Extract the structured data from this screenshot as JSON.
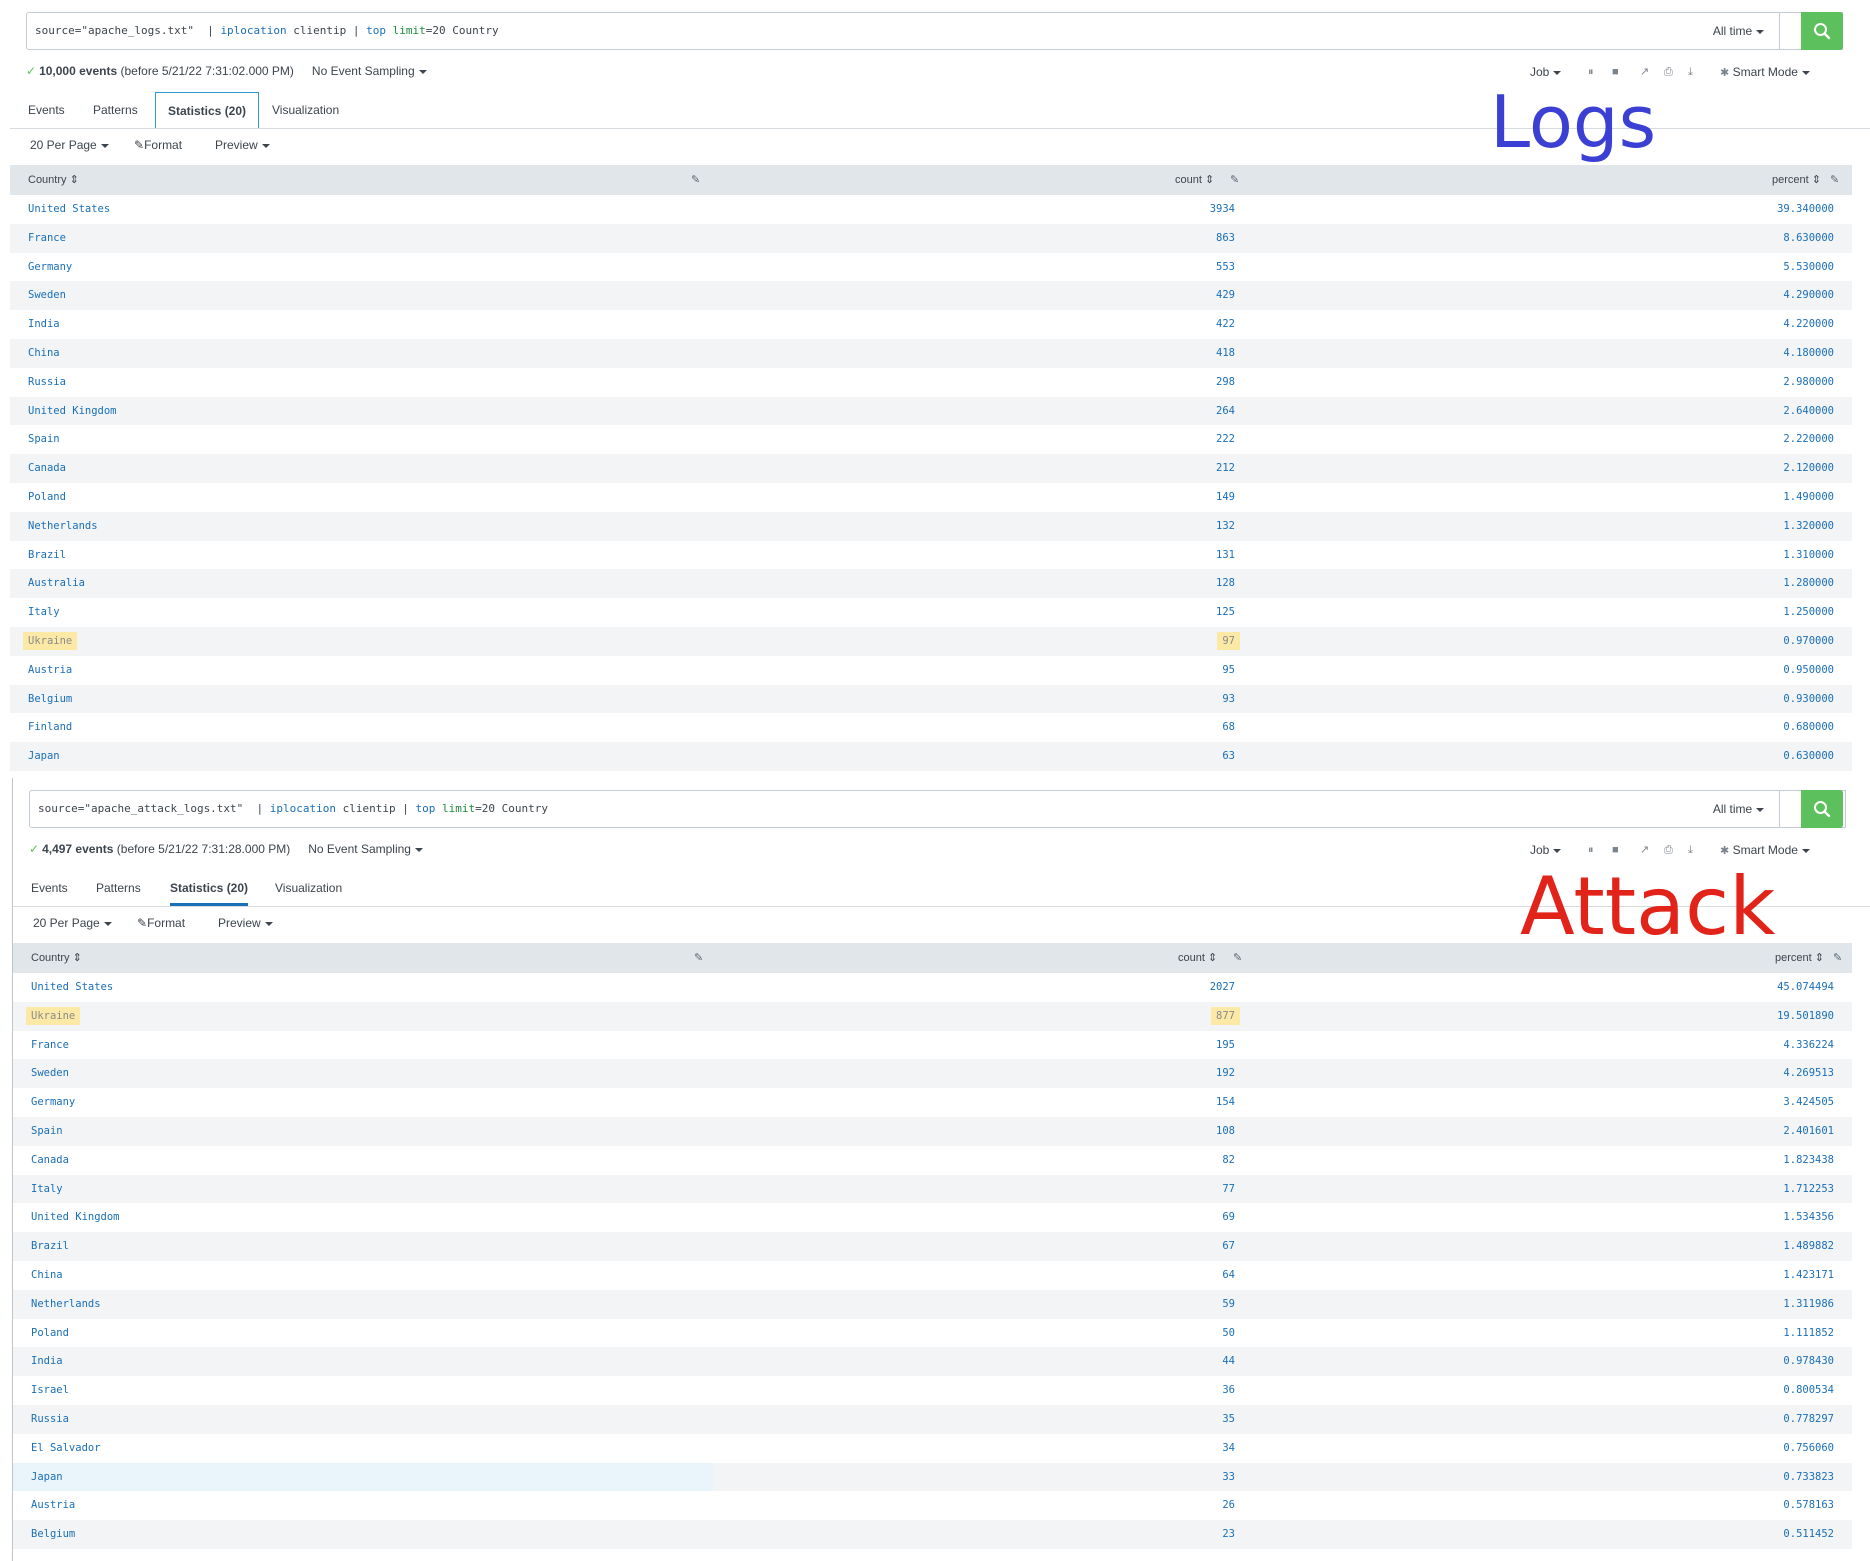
{
  "overlays": {
    "logs": "Logs",
    "attack": "Attack"
  },
  "searches": [
    {
      "query": {
        "source": "source=\"apache_logs.txt\"  | ",
        "cmd1": "iplocation",
        "mid": " clientip | ",
        "cmd2": "top",
        "sp": " ",
        "arg": "limit",
        "rest": "=20 Country"
      },
      "time_range": "All time",
      "status": {
        "count": "10,000 events",
        "detail": "(before 5/21/22 7:31:02.000 PM)",
        "sampling": "No Event Sampling"
      },
      "job": {
        "job": "Job",
        "mode": "Smart Mode"
      },
      "tabs": [
        "Events",
        "Patterns",
        "Statistics (20)",
        "Visualization"
      ],
      "toolbar": {
        "per_page": "20 Per Page",
        "format": "Format",
        "preview": "Preview"
      },
      "columns": [
        "Country",
        "count",
        "percent"
      ],
      "rows": [
        {
          "country": "United States",
          "count": "3934",
          "percent": "39.340000"
        },
        {
          "country": "France",
          "count": "863",
          "percent": "8.630000"
        },
        {
          "country": "Germany",
          "count": "553",
          "percent": "5.530000"
        },
        {
          "country": "Sweden",
          "count": "429",
          "percent": "4.290000"
        },
        {
          "country": "India",
          "count": "422",
          "percent": "4.220000"
        },
        {
          "country": "China",
          "count": "418",
          "percent": "4.180000"
        },
        {
          "country": "Russia",
          "count": "298",
          "percent": "2.980000"
        },
        {
          "country": "United Kingdom",
          "count": "264",
          "percent": "2.640000"
        },
        {
          "country": "Spain",
          "count": "222",
          "percent": "2.220000"
        },
        {
          "country": "Canada",
          "count": "212",
          "percent": "2.120000"
        },
        {
          "country": "Poland",
          "count": "149",
          "percent": "1.490000"
        },
        {
          "country": "Netherlands",
          "count": "132",
          "percent": "1.320000"
        },
        {
          "country": "Brazil",
          "count": "131",
          "percent": "1.310000"
        },
        {
          "country": "Australia",
          "count": "128",
          "percent": "1.280000"
        },
        {
          "country": "Italy",
          "count": "125",
          "percent": "1.250000"
        },
        {
          "country": "Ukraine",
          "count": "97",
          "percent": "0.970000",
          "highlight": true
        },
        {
          "country": "Austria",
          "count": "95",
          "percent": "0.950000"
        },
        {
          "country": "Belgium",
          "count": "93",
          "percent": "0.930000"
        },
        {
          "country": "Finland",
          "count": "68",
          "percent": "0.680000"
        },
        {
          "country": "Japan",
          "count": "63",
          "percent": "0.630000"
        }
      ]
    },
    {
      "query": {
        "source": "source=\"apache_attack_logs.txt\"  | ",
        "cmd1": "iplocation",
        "mid": " clientip | ",
        "cmd2": "top",
        "sp": " ",
        "arg": "limit",
        "rest": "=20 Country"
      },
      "time_range": "All time",
      "status": {
        "count": "4,497 events",
        "detail": "(before 5/21/22 7:31:28.000 PM)",
        "sampling": "No Event Sampling"
      },
      "job": {
        "job": "Job",
        "mode": "Smart Mode"
      },
      "tabs": [
        "Events",
        "Patterns",
        "Statistics (20)",
        "Visualization"
      ],
      "toolbar": {
        "per_page": "20 Per Page",
        "format": "Format",
        "preview": "Preview"
      },
      "columns": [
        "Country",
        "count",
        "percent"
      ],
      "rows": [
        {
          "country": "United States",
          "count": "2027",
          "percent": "45.074494"
        },
        {
          "country": "Ukraine",
          "count": "877",
          "percent": "19.501890",
          "highlight": true
        },
        {
          "country": "France",
          "count": "195",
          "percent": "4.336224"
        },
        {
          "country": "Sweden",
          "count": "192",
          "percent": "4.269513"
        },
        {
          "country": "Germany",
          "count": "154",
          "percent": "3.424505"
        },
        {
          "country": "Spain",
          "count": "108",
          "percent": "2.401601"
        },
        {
          "country": "Canada",
          "count": "82",
          "percent": "1.823438"
        },
        {
          "country": "Italy",
          "count": "77",
          "percent": "1.712253"
        },
        {
          "country": "United Kingdom",
          "count": "69",
          "percent": "1.534356"
        },
        {
          "country": "Brazil",
          "count": "67",
          "percent": "1.489882"
        },
        {
          "country": "China",
          "count": "64",
          "percent": "1.423171"
        },
        {
          "country": "Netherlands",
          "count": "59",
          "percent": "1.311986"
        },
        {
          "country": "Poland",
          "count": "50",
          "percent": "1.111852"
        },
        {
          "country": "India",
          "count": "44",
          "percent": "0.978430"
        },
        {
          "country": "Israel",
          "count": "36",
          "percent": "0.800534"
        },
        {
          "country": "Russia",
          "count": "35",
          "percent": "0.778297"
        },
        {
          "country": "El Salvador",
          "count": "34",
          "percent": "0.756060"
        },
        {
          "country": "Japan",
          "count": "33",
          "percent": "0.733823",
          "selected": true
        },
        {
          "country": "Austria",
          "count": "26",
          "percent": "0.578163"
        },
        {
          "country": "Belgium",
          "count": "23",
          "percent": "0.511452"
        }
      ]
    }
  ]
}
